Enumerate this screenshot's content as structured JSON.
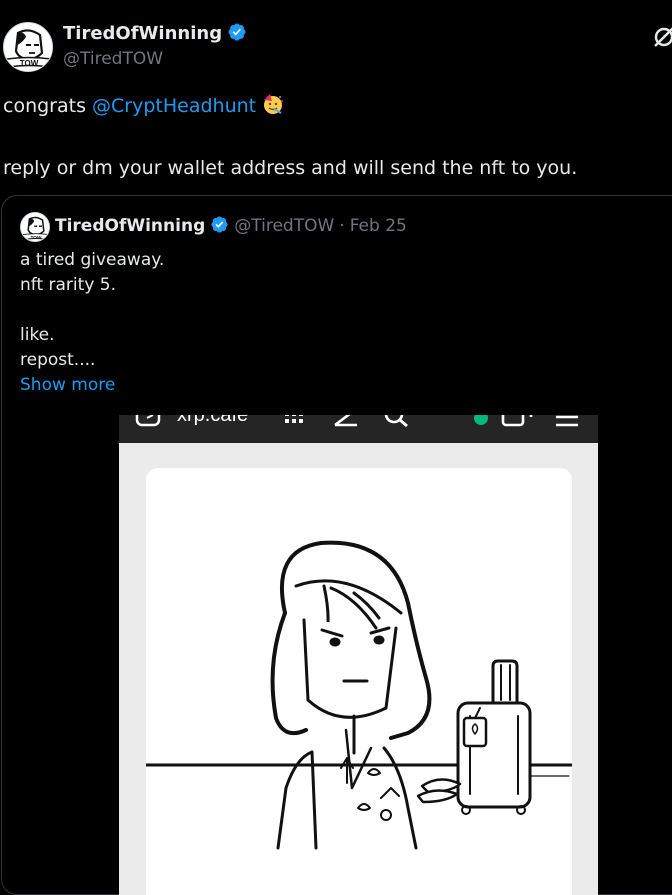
{
  "author": {
    "display_name": "TiredOfWinning",
    "handle": "@TiredTOW",
    "avatar_text": "TOW",
    "verified": true
  },
  "post": {
    "text_prefix": "congrats ",
    "mention": "@CryptHeadhunt",
    "emoji": "party-face-emoji",
    "line2": "reply or dm your wallet address and will send the nft to you."
  },
  "quoted": {
    "display_name": "TiredOfWinning",
    "handle": "@TiredTOW",
    "separator": "·",
    "date": "Feb 25",
    "lines": [
      "a tired giveaway.",
      "nft rarity 5.",
      "",
      "like.",
      "repost...."
    ],
    "show_more": "Show more"
  },
  "media": {
    "browser_url": "xrp.cafe",
    "icons": [
      "wallet-icon",
      "grid-icon",
      "chart-icon",
      "search-icon",
      "status-dot-icon",
      "tabs-icon",
      "menu-icon"
    ],
    "status_color": "#00ba7c",
    "image_subject": "line-art-girl-with-suitcase"
  },
  "colors": {
    "background": "#000000",
    "text": "#e7e9ea",
    "muted": "#71767b",
    "link": "#1d9bf0",
    "border": "#2f3336"
  }
}
